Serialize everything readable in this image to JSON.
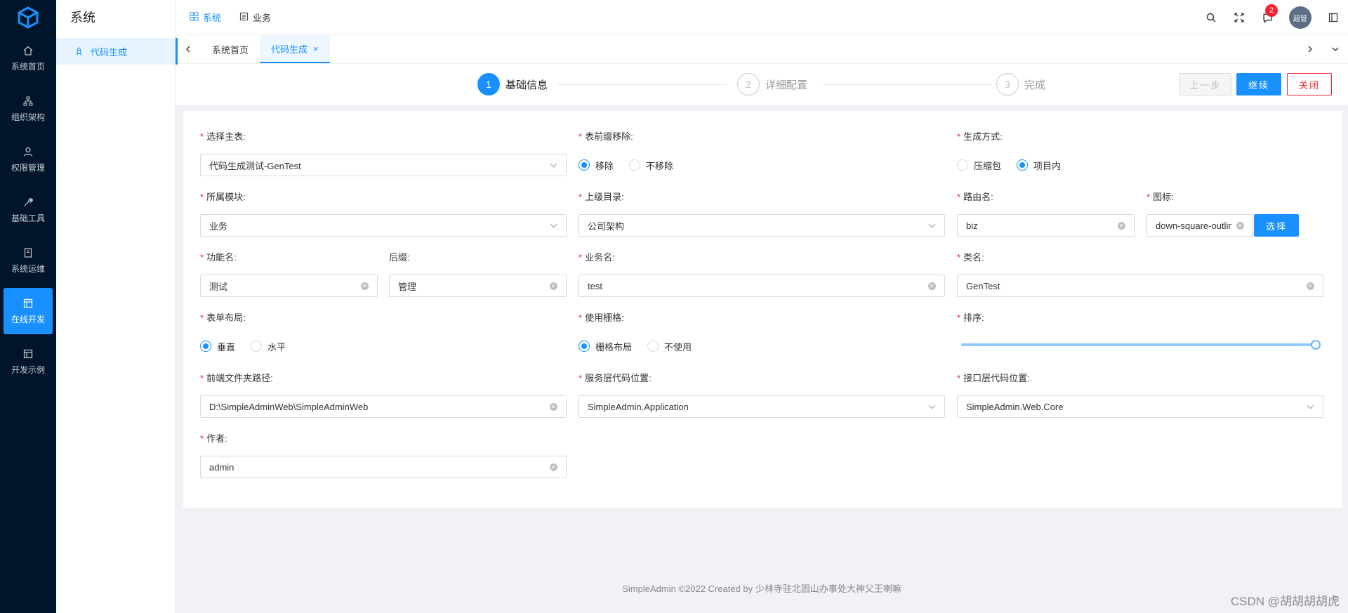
{
  "app": {
    "system_title": "系统",
    "logo_icon": "cube-logo-icon"
  },
  "leftnav": {
    "items": [
      {
        "label": "系统首页",
        "icon": "home-icon"
      },
      {
        "label": "组织架构",
        "icon": "org-tree-icon"
      },
      {
        "label": "权限管理",
        "icon": "user-icon"
      },
      {
        "label": "基础工具",
        "icon": "tool-icon"
      },
      {
        "label": "系统运维",
        "icon": "book-icon"
      },
      {
        "label": "在线开发",
        "icon": "layout-icon",
        "active": true
      },
      {
        "label": "开发示例",
        "icon": "layout-icon"
      }
    ]
  },
  "submenu": {
    "active_item": "代码生成"
  },
  "topmenu": {
    "items": [
      {
        "label": "系统",
        "active": true
      },
      {
        "label": "业务"
      }
    ]
  },
  "header": {
    "notification_count": "2",
    "avatar_text": "超管"
  },
  "tabs": {
    "items": [
      {
        "label": "系统首页"
      },
      {
        "label": "代码生成",
        "active": true,
        "closable": "×"
      }
    ]
  },
  "steps": {
    "items": [
      {
        "num": "1",
        "title": "基础信息",
        "active": true
      },
      {
        "num": "2",
        "title": "详细配置"
      },
      {
        "num": "3",
        "title": "完成"
      }
    ],
    "prev_label": "上一步",
    "next_label": "继续",
    "close_label": "关闭"
  },
  "form": {
    "main_table": {
      "label": "选择主表:",
      "value": "代码生成测试-GenTest"
    },
    "prefix_remove": {
      "label": "表前缀移除:",
      "options": [
        "移除",
        "不移除"
      ],
      "selected": "移除"
    },
    "gen_mode": {
      "label": "生成方式:",
      "options": [
        "压缩包",
        "项目内"
      ],
      "selected": "项目内"
    },
    "module": {
      "label": "所属模块:",
      "value": "业务"
    },
    "parent_dir": {
      "label": "上级目录:",
      "value": "公司架构"
    },
    "route_name": {
      "label": "路由名:",
      "value": "biz"
    },
    "icon_field": {
      "label": "图标:",
      "value": "down-square-outlined",
      "button": "选择"
    },
    "func_name": {
      "label": "功能名:",
      "value": "测试"
    },
    "suffix": {
      "label": "后缀:",
      "value": "管理"
    },
    "biz_name": {
      "label": "业务名:",
      "value": "test"
    },
    "class_name": {
      "label": "类名:",
      "value": "GenTest"
    },
    "form_layout": {
      "label": "表单布局:",
      "options": [
        "垂直",
        "水平"
      ],
      "selected": "垂直"
    },
    "use_grid": {
      "label": "使用栅格:",
      "options": [
        "栅格布局",
        "不使用"
      ],
      "selected": "栅格布局"
    },
    "sort": {
      "label": "排序:",
      "value": 100
    },
    "frontend_path": {
      "label": "前端文件夹路径:",
      "value": "D:\\SimpleAdminWeb\\SimpleAdminWeb"
    },
    "service_location": {
      "label": "服务层代码位置:",
      "value": "SimpleAdmin.Application"
    },
    "api_location": {
      "label": "接口层代码位置:",
      "value": "SimpleAdmin.Web.Core"
    },
    "author": {
      "label": "作者:",
      "value": "admin"
    }
  },
  "footer": {
    "text": "SimpleAdmin ©2022 Created by 少林寺驻北固山办事处大神父王喇嘛"
  },
  "watermark": "CSDN @胡胡胡胡虎",
  "colors": {
    "primary": "#1890ff",
    "nav_bg": "#001529",
    "danger": "#f5222d"
  }
}
